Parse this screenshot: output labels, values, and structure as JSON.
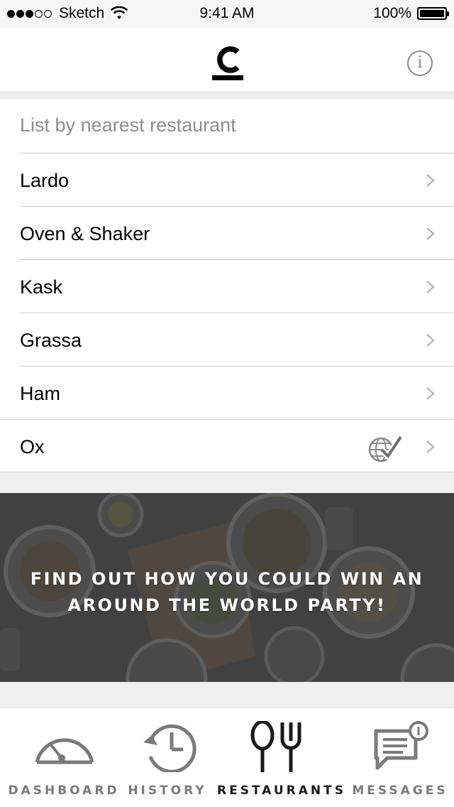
{
  "status_bar": {
    "carrier": "Sketch",
    "time": "9:41 AM",
    "battery": "100%"
  },
  "header": {
    "logo_letter": "C",
    "info_icon": "info-icon"
  },
  "list": {
    "header": "List by nearest restaurant",
    "items": [
      {
        "name": "Lardo"
      },
      {
        "name": "Oven & Shaker"
      },
      {
        "name": "Kask"
      },
      {
        "name": "Grassa"
      },
      {
        "name": "Ham"
      },
      {
        "name": "Ox",
        "badge_icon": "globe-check-icon"
      }
    ]
  },
  "promo": {
    "line1": "FIND OUT HOW YOU COULD WIN AN",
    "line2": "AROUND THE WORLD PARTY!"
  },
  "tabs": [
    {
      "label": "DASHBOARD",
      "icon": "speedometer-icon",
      "active": false
    },
    {
      "label": "HISTORY",
      "icon": "history-clock-icon",
      "active": false
    },
    {
      "label": "RESTAURANTS",
      "icon": "fork-spoon-icon",
      "active": true
    },
    {
      "label": "MESSAGES",
      "icon": "message-bubble-icon",
      "active": false
    }
  ],
  "colors": {
    "active_tab": "#1a1a1a",
    "inactive_tab": "#7a7a7a",
    "secondary_text": "#8e8e8e"
  }
}
